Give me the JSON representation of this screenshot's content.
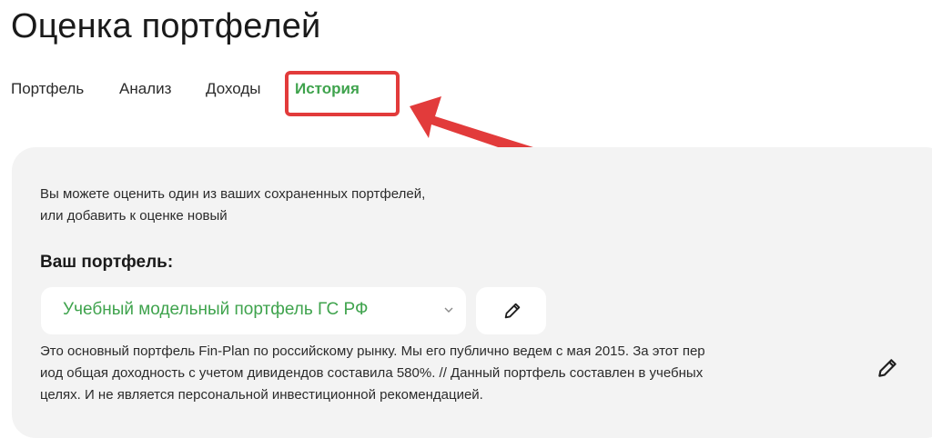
{
  "page": {
    "title": "Оценка портфелей"
  },
  "tabs": [
    {
      "label": "Портфель",
      "active": false
    },
    {
      "label": "Анализ",
      "active": false
    },
    {
      "label": "Доходы",
      "active": false
    },
    {
      "label": "История",
      "active": true
    }
  ],
  "panel": {
    "intro_line1": "Вы можете оценить один из ваших сохраненных портфелей,",
    "intro_line2": "или добавить к оценке новый",
    "portfolio_label": "Ваш портфель:",
    "selected_portfolio": "Учебный модельный портфель ГС РФ",
    "description_line1": "Это основный портфель Fin-Plan по российскому рынку. Мы его публично ведем с мая 2015. За этот пер",
    "description_line2": "иод общая доходность с учетом дивидендов составила 580%. // Данный портфель составлен в учебных",
    "description_line3": "целях. И не является персональной инвестиционной рекомендацией."
  },
  "icons": {
    "select_chevron": "chevron-down-icon",
    "edit": "pencil-icon",
    "description_edit": "pencil-icon"
  },
  "colors": {
    "accent_green": "#3fa34d",
    "annotation_red": "#e23b3b",
    "panel_bg": "#f3f3f3"
  }
}
